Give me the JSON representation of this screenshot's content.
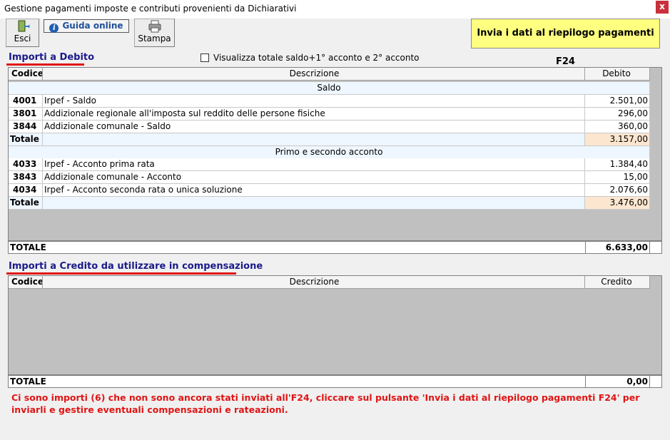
{
  "window": {
    "title": "Gestione pagamenti imposte e contributi provenienti da Dichiarativi",
    "close_label": "x"
  },
  "toolbar": {
    "esci_label": "Esci",
    "guida_label": "Guida online",
    "stampa_label": "Stampa",
    "invia_label": "Invia i dati al riepilogo pagamenti F24"
  },
  "debito": {
    "section_title": "Importi a Debito",
    "checkbox_label": "Visualizza totale saldo+1° acconto e 2° acconto",
    "checkbox_checked": false,
    "columns": [
      "Codice",
      "Descrizione",
      "Debito"
    ],
    "groups": [
      {
        "label": "Saldo",
        "rows": [
          {
            "code": "4001",
            "desc": "Irpef - Saldo",
            "amount": "2.501,00"
          },
          {
            "code": "3801",
            "desc": "Addizionale regionale all'imposta sul reddito delle persone fisiche",
            "amount": "296,00"
          },
          {
            "code": "3844",
            "desc": "Addizionale comunale - Saldo",
            "amount": "360,00"
          }
        ],
        "total_label": "Totale",
        "total": "3.157,00"
      },
      {
        "label": "Primo e secondo acconto",
        "rows": [
          {
            "code": "4033",
            "desc": "Irpef - Acconto prima rata",
            "amount": "1.384,40"
          },
          {
            "code": "3843",
            "desc": "Addizionale comunale - Acconto",
            "amount": "15,00"
          },
          {
            "code": "4034",
            "desc": "Irpef - Acconto seconda rata o unica soluzione",
            "amount": "2.076,60"
          }
        ],
        "total_label": "Totale",
        "total": "3.476,00"
      }
    ],
    "grand_total_label": "TOTALE",
    "grand_total": "6.633,00"
  },
  "credito": {
    "section_title": "Importi a Credito da utilizzare in compensazione",
    "columns": [
      "Codice",
      "Descrizione",
      "Credito"
    ],
    "grand_total_label": "TOTALE",
    "grand_total": "0,00"
  },
  "warning_text": "Ci sono importi (6) che non sono ancora stati inviati all'F24, cliccare sul pulsante 'Invia i dati al riepilogo pagamenti F24' per inviarli e gestire eventuali compensazioni e rateazioni.",
  "colors": {
    "accent_red": "#e01515",
    "section_blue": "#1a1a8a",
    "f24_yellow": "#ffff80",
    "total_peach": "#fce6d0"
  },
  "icons": {
    "esci": "exit-door-icon",
    "guida": "info-icon",
    "stampa": "printer-icon"
  }
}
